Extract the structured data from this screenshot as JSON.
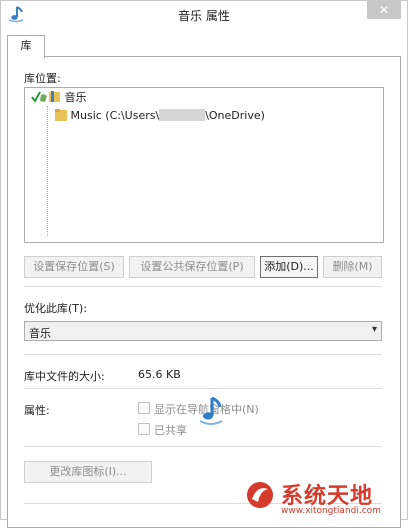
{
  "window": {
    "title": "音乐 属性",
    "close_glyph": "✕"
  },
  "tabs": [
    {
      "label": "库"
    }
  ],
  "library_locations": {
    "label": "库位置:",
    "items": [
      {
        "name": "音乐",
        "icon": "check-folder-icon"
      },
      {
        "prefix": "Music (C:\\Users\\",
        "suffix": "\\OneDrive)",
        "icon": "folder-icon"
      }
    ]
  },
  "buttons": {
    "set_save_location": "设置保存位置(S)",
    "set_public_save_location": "设置公共保存位置(P)",
    "add": "添加(D)...",
    "remove": "删除(M)",
    "change_icon": "更改库图标(I)..."
  },
  "optimize": {
    "label": "优化此库(T):",
    "selected": "音乐"
  },
  "size": {
    "label": "库中文件的大小:",
    "value": "65.6 KB"
  },
  "attributes": {
    "label": "属性:",
    "show_in_nav": "显示在导航窗格中(N)",
    "shared": "已共享"
  },
  "watermark": {
    "title": "系统天地",
    "url": "www.xitongtiandi.com"
  },
  "colors": {
    "accent": "#d63a2c",
    "border": "#adadad",
    "disabled_text": "#8d8d8d"
  }
}
